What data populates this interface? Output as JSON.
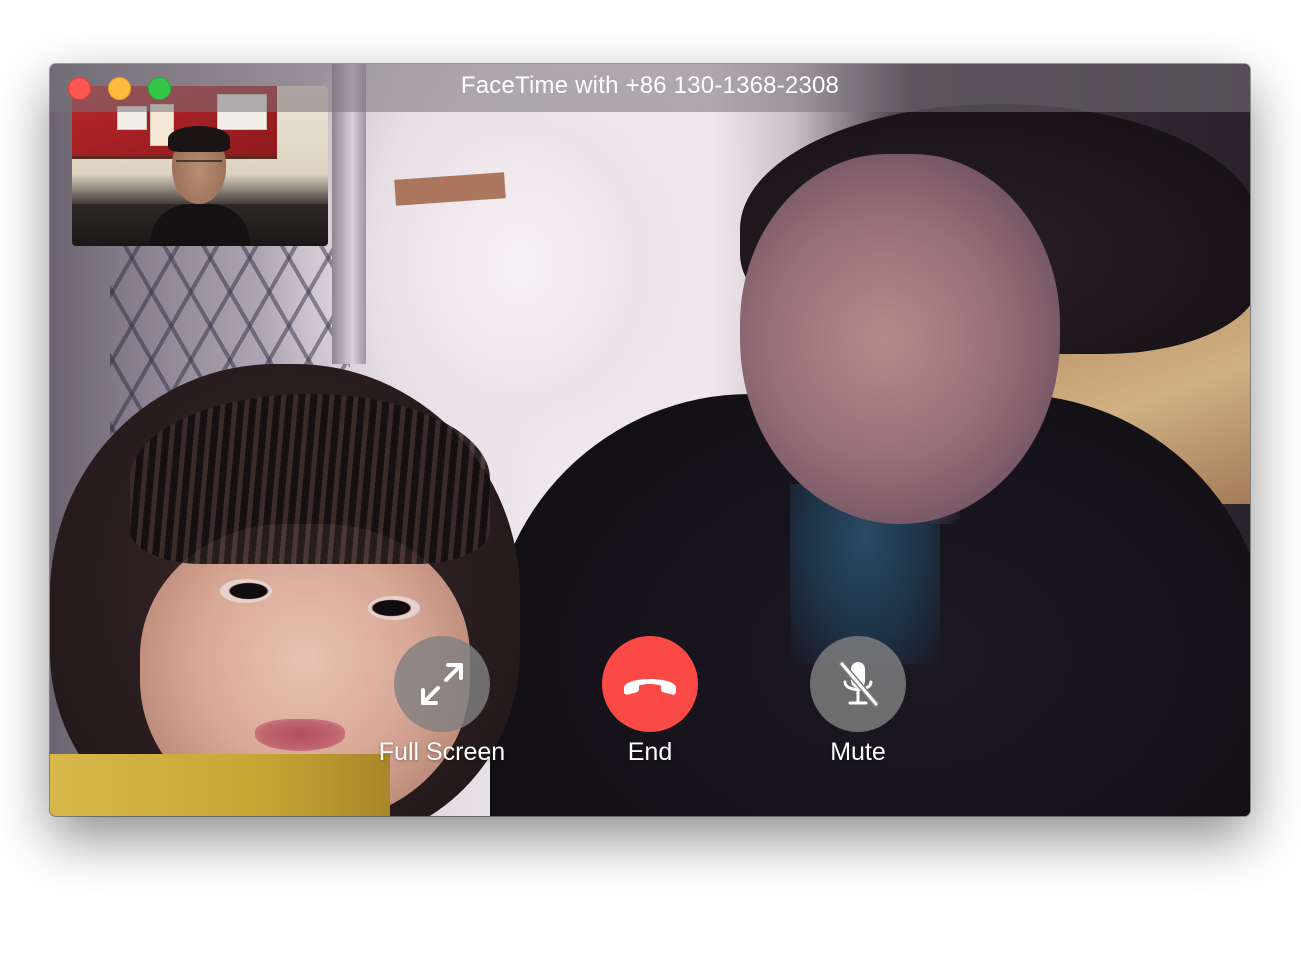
{
  "window": {
    "title": "FaceTime with +86 130-1368-2308",
    "traffic_lights": {
      "close_color": "#fc5753",
      "minimize_color": "#fdbc40",
      "zoom_color": "#33c748"
    }
  },
  "self_preview": {
    "icon": "camera-preview"
  },
  "controls": {
    "full_screen": {
      "label": "Full Screen",
      "icon": "expand-arrows-icon",
      "color": "#808080"
    },
    "end": {
      "label": "End",
      "icon": "phone-hangup-icon",
      "color": "#fb4a45"
    },
    "mute": {
      "label": "Mute",
      "icon": "microphone-muted-icon",
      "color": "#808080"
    }
  }
}
